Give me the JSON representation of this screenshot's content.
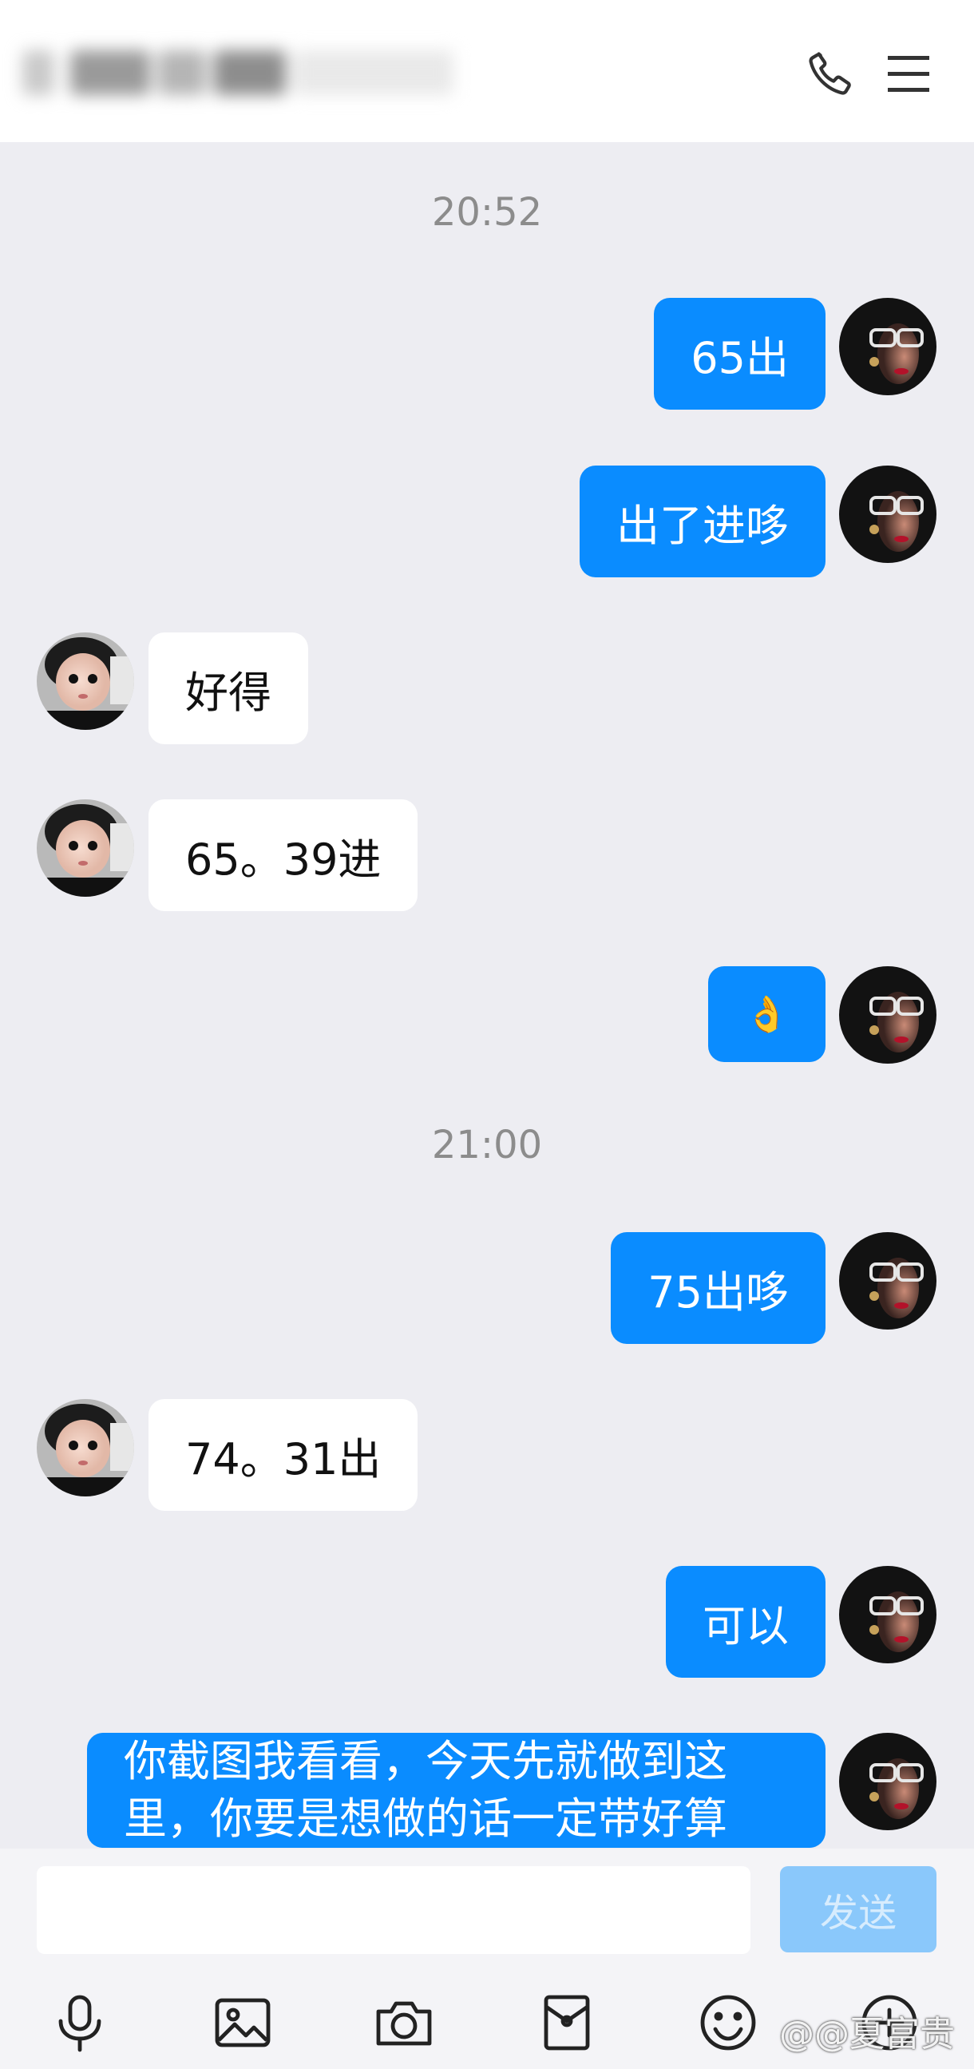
{
  "header": {
    "title": "",
    "call_icon": "phone-icon",
    "menu_icon": "menu-icon"
  },
  "colors": {
    "outgoing_bubble": "#0a8cff",
    "incoming_bubble": "#ffffff",
    "chat_background": "#ededf2",
    "send_button": "#8ac8fb"
  },
  "messages": {
    "t1": "20:52",
    "m1": "65出",
    "m2": "出了进哆",
    "m3": "好得",
    "m4": "65。39进",
    "m5": "👌",
    "t2": "21:00",
    "m6": "75出哆",
    "m7": "74。31出",
    "m8": "可以",
    "m9": "你截图我看看，今天先就做到这里，你要是想做的话一定带好算"
  },
  "input": {
    "value": "",
    "send_label": "发送"
  },
  "toolbar": {
    "icons": [
      "microphone-icon",
      "image-icon",
      "camera-icon",
      "red-packet-icon",
      "emoji-icon",
      "more-icon"
    ]
  },
  "watermark": "@@夏富贵"
}
